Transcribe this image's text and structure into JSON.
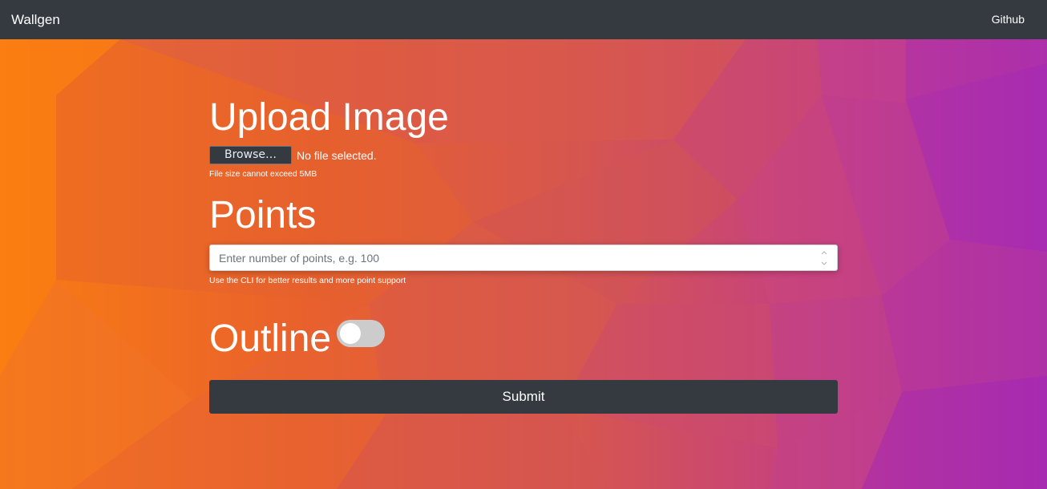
{
  "navbar": {
    "brand": "Wallgen",
    "links": [
      "Github"
    ]
  },
  "upload": {
    "heading": "Upload Image",
    "browse_label": "Browse…",
    "file_status": "No file selected.",
    "help": "File size cannot exceed 5MB"
  },
  "points": {
    "heading": "Points",
    "placeholder": "Enter number of points, e.g. 100",
    "help": "Use the CLI for better results and more point support"
  },
  "outline": {
    "heading": "Outline",
    "toggle_on": false
  },
  "submit": {
    "label": "Submit"
  },
  "colors": {
    "navbar": "#343a40",
    "gradient_left": "#f97c12",
    "gradient_mid": "#d85a4c",
    "gradient_right": "#a62ab1"
  }
}
